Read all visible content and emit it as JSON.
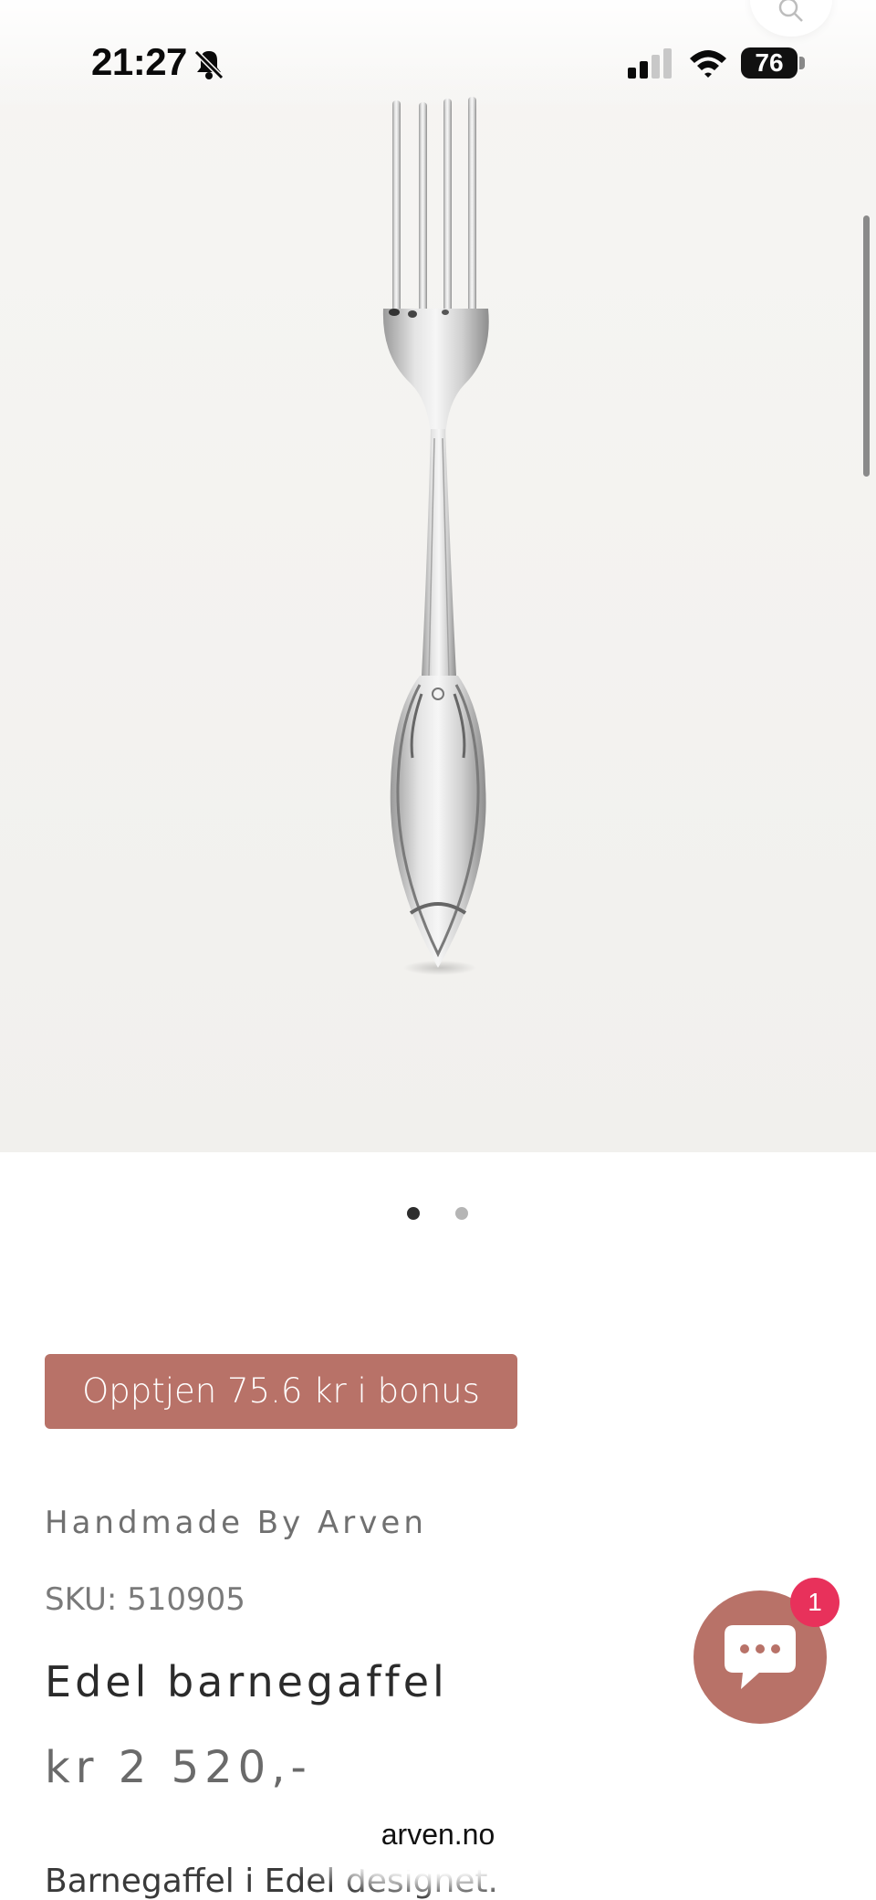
{
  "status_bar": {
    "time": "21:27",
    "battery": "76"
  },
  "gallery": {
    "image_count": 2,
    "active_index": 0
  },
  "product": {
    "bonus_label": "Opptjen 75.6 kr i bonus",
    "vendor": "Handmade By Arven",
    "sku": "SKU: 510905",
    "title": "Edel barnegaffel",
    "price": "kr 2 520,-",
    "description": "Barnegaffel i Edel designet."
  },
  "chat": {
    "badge_count": "1"
  },
  "browser": {
    "domain": "arven.no"
  },
  "colors": {
    "accent": "#b87268",
    "badge": "#e8315b"
  }
}
